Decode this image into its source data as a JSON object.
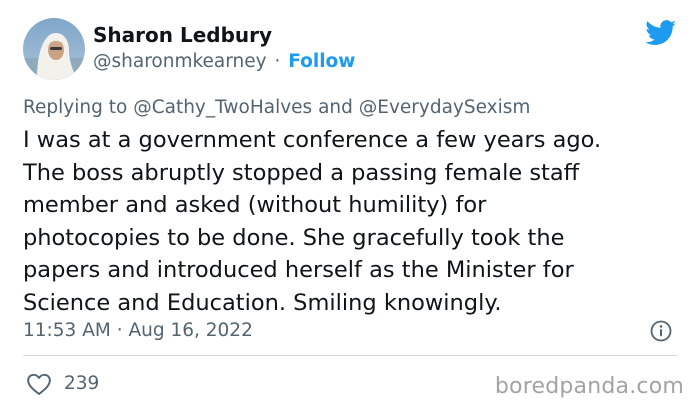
{
  "author": {
    "name": "Sharon Ledbury",
    "handle": "@sharonmkearney",
    "separator": "·",
    "follow_label": "Follow",
    "avatar_icon": "profile-photo"
  },
  "brand": {
    "icon": "twitter-bird-icon",
    "accent": "#1d9bf0"
  },
  "reply": {
    "prefix": "Replying to",
    "mention_1": "@Cathy_TwoHalves",
    "conjunction": "and",
    "mention_2": "@EverydaySexism"
  },
  "tweet": {
    "text": "I was at a government conference a few years ago.\nThe boss abruptly stopped a passing female staff\nmember and asked (without humility) for\nphotocopies to be done. She gracefully took the\npapers and introduced herself as the Minister for\nScience and Education. Smiling knowingly."
  },
  "meta": {
    "timestamp": "11:53 AM · Aug 16, 2022",
    "info_icon": "info-icon"
  },
  "actions": {
    "like_icon": "heart-icon",
    "like_count": "239"
  },
  "watermark": {
    "text": "boredpanda.com"
  }
}
